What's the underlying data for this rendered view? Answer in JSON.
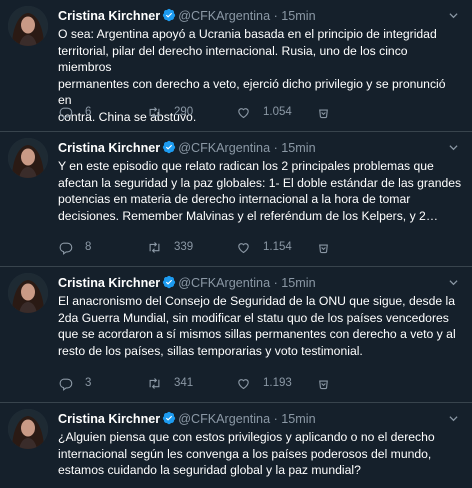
{
  "tweets": [
    {
      "author": "Cristina Kirchner",
      "handle": "@CFKArgentina",
      "separator": "·",
      "time": "15min",
      "text": "O sea: Argentina apoyó a Ucrania basada en el principio de integridad\nterritorial, pilar del derecho internacional. Rusia, uno de los cinco miembros\npermanentes con derecho a veto, ejerció dicho privilegio y se pronunció en\ncontra. China se abstuvo.",
      "replies": "6",
      "retweets": "290",
      "likes": "1.054"
    },
    {
      "author": "Cristina Kirchner",
      "handle": "@CFKArgentina",
      "separator": "·",
      "time": "15min",
      "text": "Y en este episodio que relato radican los 2 principales problemas que\nafectan la seguridad y la paz globales: 1- El doble estándar de las grandes\npotencias en materia de derecho internacional a la hora de tomar\ndecisiones. Remember Malvinas y el referéndum de los Kelpers, y 2…",
      "replies": "8",
      "retweets": "339",
      "likes": "1.154"
    },
    {
      "author": "Cristina Kirchner",
      "handle": "@CFKArgentina",
      "separator": "·",
      "time": "15min",
      "text": "El anacronismo del Consejo de Seguridad de la ONU que sigue, desde la\n2da Guerra Mundial, sin modificar el statu quo de los países vencedores\nque se acordaron a sí mismos sillas permanentes con derecho a veto y al\nresto de los países, sillas temporarias y voto testimonial.",
      "replies": "3",
      "retweets": "341",
      "likes": "1.193"
    },
    {
      "author": "Cristina Kirchner",
      "handle": "@CFKArgentina",
      "separator": "·",
      "time": "15min",
      "text": "¿Alguien piensa que con estos privilegios y aplicando o no el derecho\ninternacional según les convenga a los países poderosos del mundo,\nestamos cuidando la seguridad global y la paz mundial?",
      "replies": "",
      "retweets": "",
      "likes": ""
    }
  ],
  "icons": {
    "verified": "verified-badge-icon",
    "more": "chevron-down-icon",
    "reply": "reply-icon",
    "retweet": "retweet-icon",
    "like": "heart-icon",
    "share": "share-icon"
  },
  "colors": {
    "background": "#15202b",
    "text": "#ffffff",
    "muted": "#8b98a5",
    "divider": "#38444d",
    "verified": "#1d9bf0"
  }
}
